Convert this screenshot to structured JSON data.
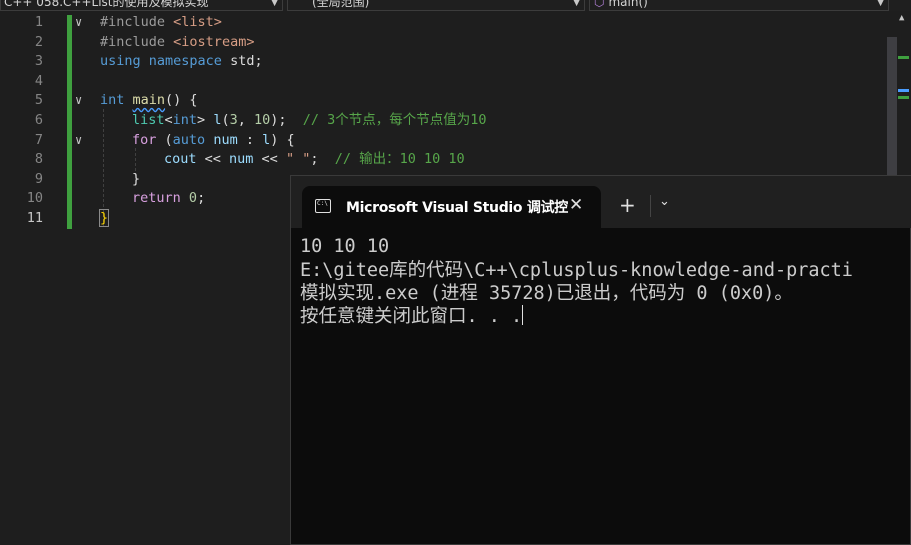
{
  "nav": {
    "project": "C++ 058.C++List的使用及模拟实现",
    "scope": "(全局范围)",
    "member": "main()"
  },
  "editor": {
    "line_numbers": [
      "1",
      "2",
      "3",
      "4",
      "5",
      "6",
      "7",
      "8",
      "9",
      "10",
      "11"
    ],
    "code": {
      "l1_dir": "#include",
      "l1_hdr": "<list>",
      "l2_dir": "#include",
      "l2_hdr": "<iostream>",
      "l3_using": "using",
      "l3_ns": "namespace",
      "l3_std": "std;",
      "l5_int": "int",
      "l5_main": "main",
      "l5_rest": "() {",
      "l6_list": "list",
      "l6_tpl_open": "<",
      "l6_int": "int",
      "l6_tpl_close": ">",
      "l6_var": " l",
      "l6_p1": "(",
      "l6_n1": "3",
      "l6_comma": ", ",
      "l6_n2": "10",
      "l6_p2": ");",
      "l6_comment": "// 3个节点，每个节点值为10",
      "l7_for": "for",
      "l7_p1": " (",
      "l7_auto": "auto",
      "l7_num": "num",
      "l7_colon": " : ",
      "l7_l": "l",
      "l7_p2": ") {",
      "l8_cout": "cout",
      "l8_op1": " << ",
      "l8_num": "num",
      "l8_op2": " << ",
      "l8_str": "\" \"",
      "l8_semi": ";",
      "l8_comment": "// 输出：10 10 10",
      "l9_brace": "}",
      "l10_return": "return",
      "l10_zero": "0",
      "l10_semi": ";",
      "l11_brace": "}"
    }
  },
  "console": {
    "tab_title": "Microsoft Visual Studio 调试控",
    "close_glyph": "✕",
    "new_tab_glyph": "+",
    "dropdown_glyph": "⌄",
    "output": [
      "10 10 10",
      "E:\\gitee库的代码\\C++\\cplusplus-knowledge-and-practi",
      "模拟实现.exe (进程 35728)已退出，代码为 0 (0x0)。",
      "按任意键关闭此窗口. . ."
    ]
  },
  "colors": {
    "editor_bg": "#1e1e1e",
    "console_bg": "#0c0c0c",
    "change_bar": "#3fa03f",
    "keyword": "#569cd6",
    "comment": "#57a64a"
  }
}
